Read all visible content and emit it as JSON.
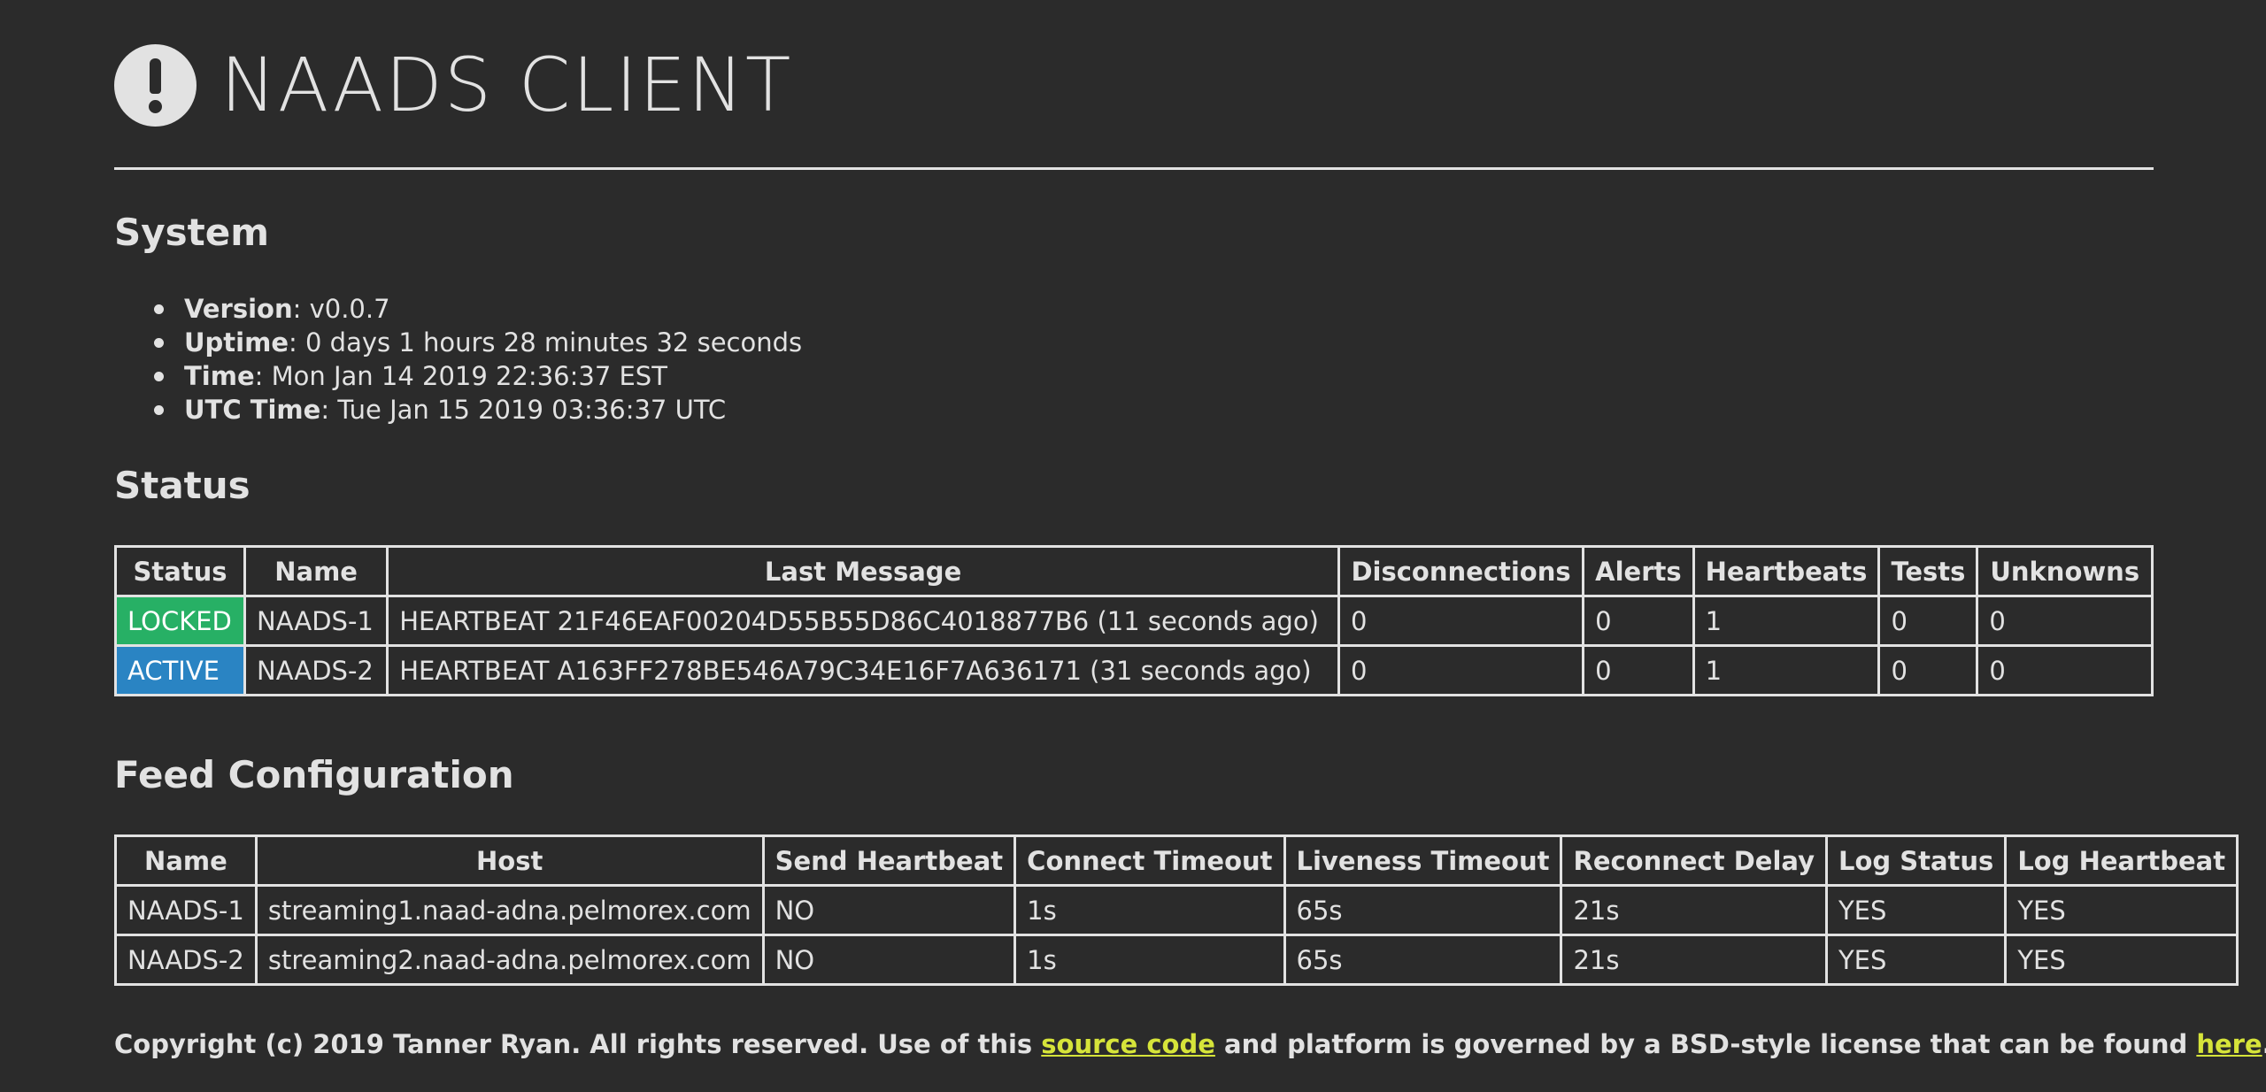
{
  "header": {
    "title": "NAADS CLIENT",
    "icon": "exclamation-circle-icon"
  },
  "system": {
    "heading": "System",
    "items": [
      {
        "label": "Version",
        "value": ": v0.0.7"
      },
      {
        "label": "Uptime",
        "value": ": 0 days 1 hours 28 minutes 32 seconds"
      },
      {
        "label": "Time",
        "value": ": Mon Jan 14 2019 22:36:37 EST"
      },
      {
        "label": "UTC Time",
        "value": ": Tue Jan 15 2019 03:36:37 UTC"
      }
    ]
  },
  "status": {
    "heading": "Status",
    "columns": [
      "Status",
      "Name",
      "Last Message",
      "Disconnections",
      "Alerts",
      "Heartbeats",
      "Tests",
      "Unknowns"
    ],
    "rows": [
      {
        "status": "LOCKED",
        "status_color": "#27b065",
        "name": "NAADS-1",
        "last_message": "HEARTBEAT 21F46EAF00204D55B55D86C4018877B6 (11 seconds ago)",
        "disconnections": "0",
        "alerts": "0",
        "heartbeats": "1",
        "tests": "0",
        "unknowns": "0"
      },
      {
        "status": "ACTIVE",
        "status_color": "#2a84c3",
        "name": "NAADS-2",
        "last_message": "HEARTBEAT A163FF278BE546A79C34E16F7A636171 (31 seconds ago)",
        "disconnections": "0",
        "alerts": "0",
        "heartbeats": "1",
        "tests": "0",
        "unknowns": "0"
      }
    ]
  },
  "feed": {
    "heading": "Feed Configuration",
    "columns": [
      "Name",
      "Host",
      "Send Heartbeat",
      "Connect Timeout",
      "Liveness Timeout",
      "Reconnect Delay",
      "Log Status",
      "Log Heartbeat"
    ],
    "rows": [
      {
        "name": "NAADS-1",
        "host": "streaming1.naad-adna.pelmorex.com",
        "send_heartbeat": "NO",
        "connect_timeout": "1s",
        "liveness_timeout": "65s",
        "reconnect_delay": "21s",
        "log_status": "YES",
        "log_heartbeat": "YES"
      },
      {
        "name": "NAADS-2",
        "host": "streaming2.naad-adna.pelmorex.com",
        "send_heartbeat": "NO",
        "connect_timeout": "1s",
        "liveness_timeout": "65s",
        "reconnect_delay": "21s",
        "log_status": "YES",
        "log_heartbeat": "YES"
      }
    ]
  },
  "footer": {
    "text_before": "Copyright (c) 2019 Tanner Ryan. All rights reserved. Use of this ",
    "link1": "source code",
    "text_middle": " and platform is governed by a BSD-style license that can be found ",
    "link2": "here",
    "text_after": "."
  },
  "colors": {
    "background": "#2b2b2b",
    "text": "#e2e2e2",
    "link": "#d6e43a",
    "locked": "#27b065",
    "active": "#2a84c3"
  }
}
